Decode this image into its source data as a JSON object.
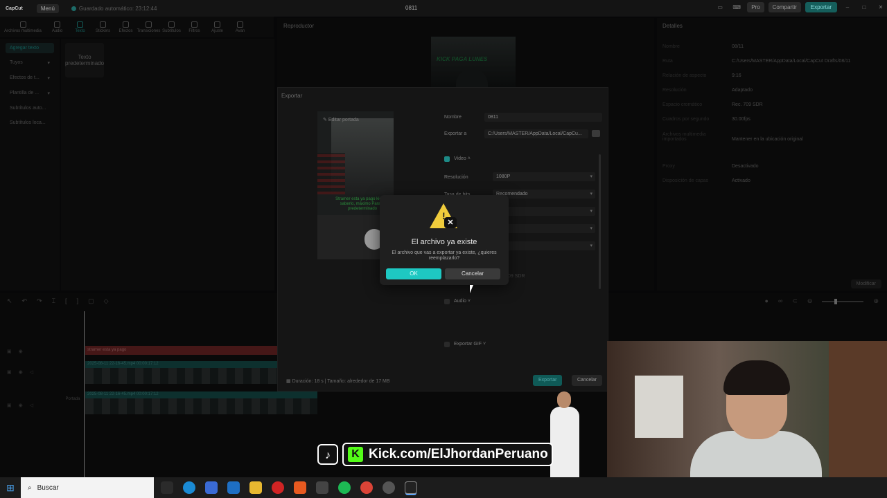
{
  "titlebar": {
    "app": "CapCut",
    "menu": "Menú",
    "autosave": "Guardado automático: 23:12:44",
    "project": "0811",
    "pro": "Pro",
    "share": "Compartir",
    "export": "Exportar"
  },
  "toolbar": {
    "items": [
      "Archivos multimedia",
      "Audio",
      "Texto",
      "Stickers",
      "Efectos",
      "Transiciones",
      "Subtítulos",
      "Filtros",
      "Ajuste",
      "Avan"
    ]
  },
  "leftnav": {
    "items": [
      "Agregar texto",
      "Tuyos",
      "Efectos de t...",
      "Plantilla de ...",
      "Subtítulos auto...",
      "Subtítulos loca..."
    ]
  },
  "leftcontent": {
    "card": "Texto predeterminado"
  },
  "player": {
    "header": "Reproductor",
    "overlay_text": "KICK PAGA LUNES"
  },
  "details": {
    "header": "Detalles",
    "rows": [
      {
        "k": "Nombre",
        "v": "08/11"
      },
      {
        "k": "Ruta",
        "v": "C:/Users/MASTER/AppData/Local/CapCut Drafts/08/11"
      },
      {
        "k": "Relación de aspecto",
        "v": "9:16"
      },
      {
        "k": "Resolución",
        "v": "Adaptado"
      },
      {
        "k": "Espacio cromático",
        "v": "Rec. 709 SDR"
      },
      {
        "k": "Cuadros por segundo",
        "v": "30.00fps"
      },
      {
        "k": "Archivos multimedia importados",
        "v": "Mantener en la ubicación original"
      },
      {
        "k": "Proxy",
        "v": "Desactivado"
      },
      {
        "k": "Disposición de capas",
        "v": "Activado"
      }
    ],
    "modify": "Modificar"
  },
  "timeline": {
    "text_clip": "stramer esta ya pago",
    "clip1": "2025-08-11 22-16-45.mp4   00:00:17:12",
    "clip2": "2025-08-11 22-16-45.mp4   00:00:17:12",
    "cover": "Portada"
  },
  "export_dialog": {
    "title": "Exportar",
    "edit_cover": "Editar portada",
    "cover_caption": "Stramer esta ya pago kick de saberlo, máximo Para el predeterminado",
    "name_label": "Nombre",
    "name_value": "0811",
    "path_label": "Exportar a",
    "path_value": "C:/Users/MASTER/AppData/Local/CapCu...",
    "video_label": "Video",
    "resolution_label": "Resolución",
    "resolution_value": "1080P",
    "bitrate_label": "Tasa de bits",
    "bitrate_value": "Recomendado",
    "color_value": "09 SDR",
    "audio_label": "Audio",
    "gif_label": "Exportar GIF",
    "footer": "Duración: 18 s | Tamaño: alrededor de 17 MB",
    "export_btn": "Exportar",
    "cancel_btn": "Cancelar"
  },
  "confirm": {
    "title": "El archivo ya existe",
    "message": "El archivo que vas a exportar ya existe, ¿quieres reemplazarlo?",
    "ok": "OK",
    "cancel": "Cancelar"
  },
  "overlay": {
    "kick": "Kick.com/ElJhordanPeruano"
  },
  "taskbar": {
    "search": "Buscar"
  },
  "colors": {
    "accent": "#1ec8c2",
    "warning": "#f0cc3c",
    "kick": "#53fc18"
  }
}
